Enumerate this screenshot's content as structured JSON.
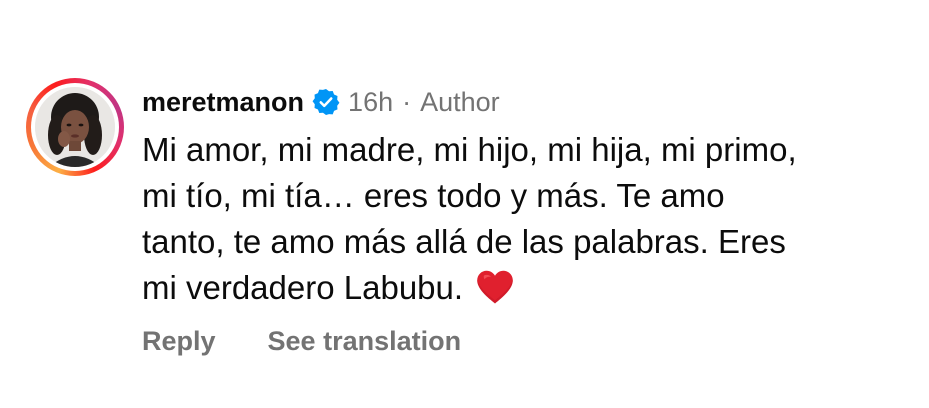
{
  "comment": {
    "username": "meretmanon",
    "verified": true,
    "time": "16h",
    "separator": "·",
    "role": "Author",
    "lines": [
      "Mi amor, mi madre, mi hijo, mi hija, mi primo,",
      "mi tío, mi tía… eres todo y más. Te amo",
      "tanto, te amo más allá de las palabras. Eres",
      "mi verdadero Labubu."
    ],
    "emoji": "red-heart-emoji"
  },
  "actions": {
    "reply_label": "Reply",
    "translate_label": "See translation"
  },
  "colors": {
    "text_primary": "#0c0c0c",
    "text_secondary": "#737373",
    "verified_blue": "#0095f6",
    "heart_red": "#e0202e"
  },
  "icons": {
    "verified": "verified-badge-icon",
    "heart": "red-heart-icon"
  }
}
